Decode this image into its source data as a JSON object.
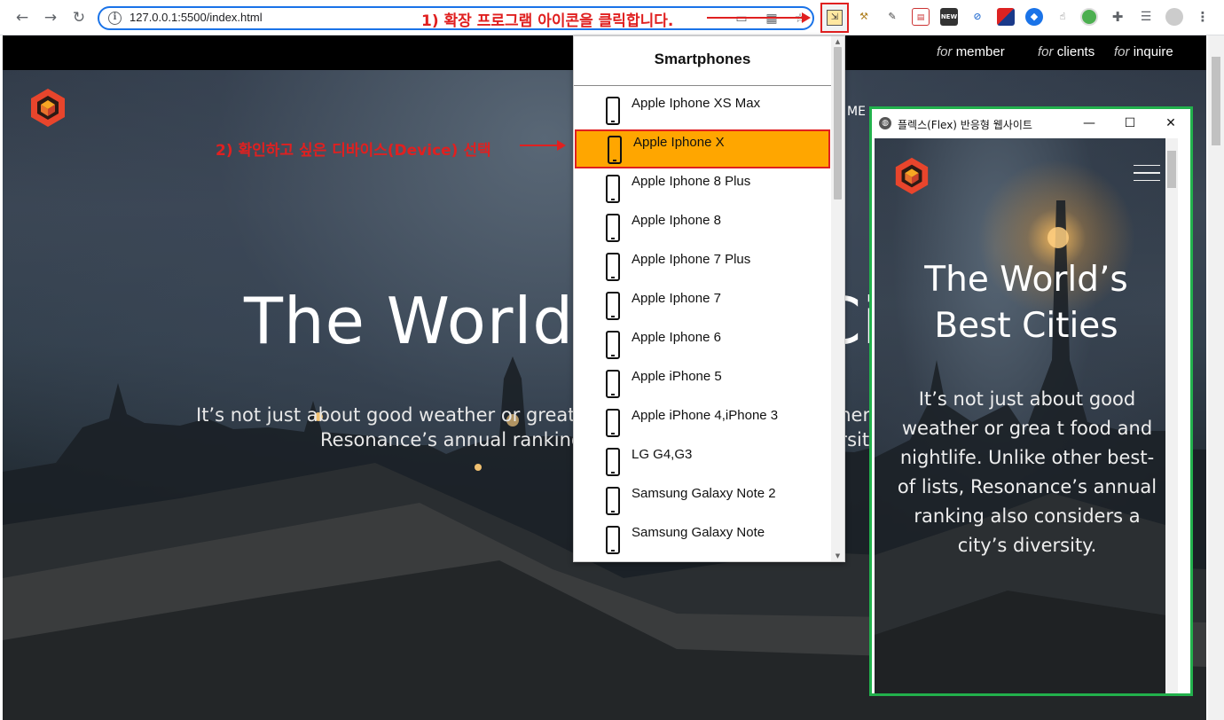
{
  "browser": {
    "url": "127.0.0.1:5500/index.html",
    "back_icon": "arrow-left-icon",
    "forward_icon": "arrow-right-icon",
    "reload_icon": "reload-icon",
    "annotation_step1": "1) 확장 프로그램 아이콘을 클릭합니다.",
    "annotation_color": "#e02020"
  },
  "page": {
    "top_links": [
      {
        "prefix": "for",
        "label": "member"
      },
      {
        "prefix": "for",
        "label": "clients"
      },
      {
        "prefix": "for",
        "label": "inquire"
      }
    ],
    "menu_fragment": "ME",
    "hero_title": "The World’s Best Cities",
    "hero_subtitle_line1": "It’s not just about good weather or great food and nightlife. Unlike other",
    "hero_subtitle_line2": "Resonance’s annual ranking also considers a city’s diversity.",
    "annotation_step2": "2) 확인하고 싶은 디바이스(Device) 선택"
  },
  "dropdown": {
    "header": "Smartphones",
    "selected_color": "#ffa600",
    "items": [
      {
        "label": "Apple Iphone XS Max",
        "selected": false
      },
      {
        "label": "Apple Iphone X",
        "selected": true
      },
      {
        "label": "Apple Iphone 8 Plus",
        "selected": false
      },
      {
        "label": "Apple Iphone 8",
        "selected": false
      },
      {
        "label": "Apple Iphone 7 Plus",
        "selected": false
      },
      {
        "label": "Apple Iphone 7",
        "selected": false
      },
      {
        "label": "Apple Iphone 6",
        "selected": false
      },
      {
        "label": "Apple iPhone 5",
        "selected": false
      },
      {
        "label": "Apple iPhone 4,iPhone 3",
        "selected": false
      },
      {
        "label": "LG G4,G3",
        "selected": false
      },
      {
        "label": "Samsung Galaxy Note 2",
        "selected": false
      },
      {
        "label": "Samsung Galaxy Note",
        "selected": false
      }
    ]
  },
  "popup": {
    "window_title": "플렉스(Flex) 반응형 웹사이트",
    "minimize": "—",
    "maximize": "☐",
    "close": "✕",
    "hero_title_line1": "The World’s",
    "hero_title_line2": "Best Cities",
    "hero_subtitle": "It’s not just about good weather or grea t food and nightlife. Unlike other best-of lists, Resonance’s annual ranking also considers a city’s diversity.",
    "border_color": "#22b14c"
  }
}
